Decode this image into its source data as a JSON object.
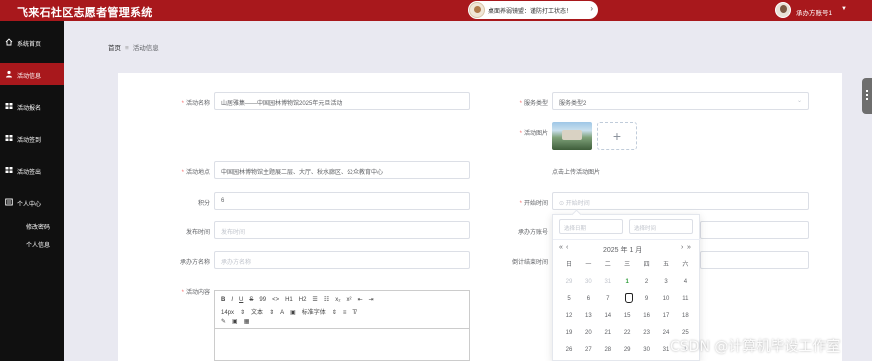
{
  "app_title": "飞来石社区志愿者管理系统",
  "notice": {
    "text": "桌面养弱镜盟：谨防打工状态！",
    "arrow": "›"
  },
  "user": {
    "name": "承办方账号1",
    "caret": "▼"
  },
  "sidebar": {
    "items": [
      {
        "label": "系统首页",
        "icon": "home-icon"
      },
      {
        "label": "活动信息",
        "icon": "user-icon"
      },
      {
        "label": "活动报名",
        "icon": "grid-icon"
      },
      {
        "label": "活动签到",
        "icon": "grid-icon"
      },
      {
        "label": "活动签出",
        "icon": "grid-icon"
      },
      {
        "label": "个人中心",
        "icon": "personal-icon"
      }
    ],
    "subitems": [
      "修改密码",
      "个人信息"
    ]
  },
  "breadcrumb": {
    "home": "首页",
    "sep": "≡",
    "current": "活动信息"
  },
  "form": {
    "activity_name": {
      "label": "活动名称",
      "value": "山居雅集——中国园林博物馆2025年元旦活动"
    },
    "service_type": {
      "label": "服务类型",
      "value": "服务类型2"
    },
    "activity_image": {
      "label": "活动图片",
      "hint": "点击上传活动图片",
      "add": "+"
    },
    "activity_location": {
      "label": "活动地点",
      "value": "中国园林博物馆主题展二层、大厅、秋水廊区、公众教育中心"
    },
    "points": {
      "label": "积分",
      "value": "6"
    },
    "start_time": {
      "label": "开始时间",
      "placeholder": "开始时间"
    },
    "publish_time": {
      "label": "发布时间",
      "placeholder": "发布时间"
    },
    "organizer_account": {
      "label": "承办方账号"
    },
    "organizer_name": {
      "label": "承办方名称",
      "placeholder": "承办方名称"
    },
    "countdown_end": {
      "label": "倒计结束时间"
    },
    "content": {
      "label": "活动内容"
    }
  },
  "editor": {
    "row1": [
      "B",
      "I",
      "U",
      "S",
      "99",
      "<>",
      "H1",
      "H2",
      "☰",
      "☷",
      "x₂",
      "x²",
      "⇤",
      "⇥"
    ],
    "row2": [
      "14px",
      "⇕",
      "文本",
      "⇕",
      "A",
      "▣",
      "标准字体",
      "⇕",
      "≡",
      "T̸"
    ],
    "row3": [
      "✎",
      "▣",
      "▦"
    ]
  },
  "datepicker": {
    "date_placeholder": "选择日期",
    "time_placeholder": "选择时间",
    "year_month": "2025 年 1 月",
    "prev_year": "«",
    "prev_month": "‹",
    "next_month": "›",
    "next_year": "»",
    "weekdays": [
      "日",
      "一",
      "二",
      "三",
      "四",
      "五",
      "六"
    ],
    "weeks": [
      [
        "29",
        "30",
        "31",
        "1",
        "2",
        "3",
        "4"
      ],
      [
        "5",
        "6",
        "7",
        "8",
        "9",
        "10",
        "11"
      ],
      [
        "12",
        "13",
        "14",
        "15",
        "16",
        "17",
        "18"
      ],
      [
        "19",
        "20",
        "21",
        "22",
        "23",
        "24",
        "25"
      ],
      [
        "26",
        "27",
        "28",
        "29",
        "30",
        "31",
        "1"
      ]
    ],
    "today": "1"
  },
  "watermark": "CSDN @计算机毕设工作室"
}
